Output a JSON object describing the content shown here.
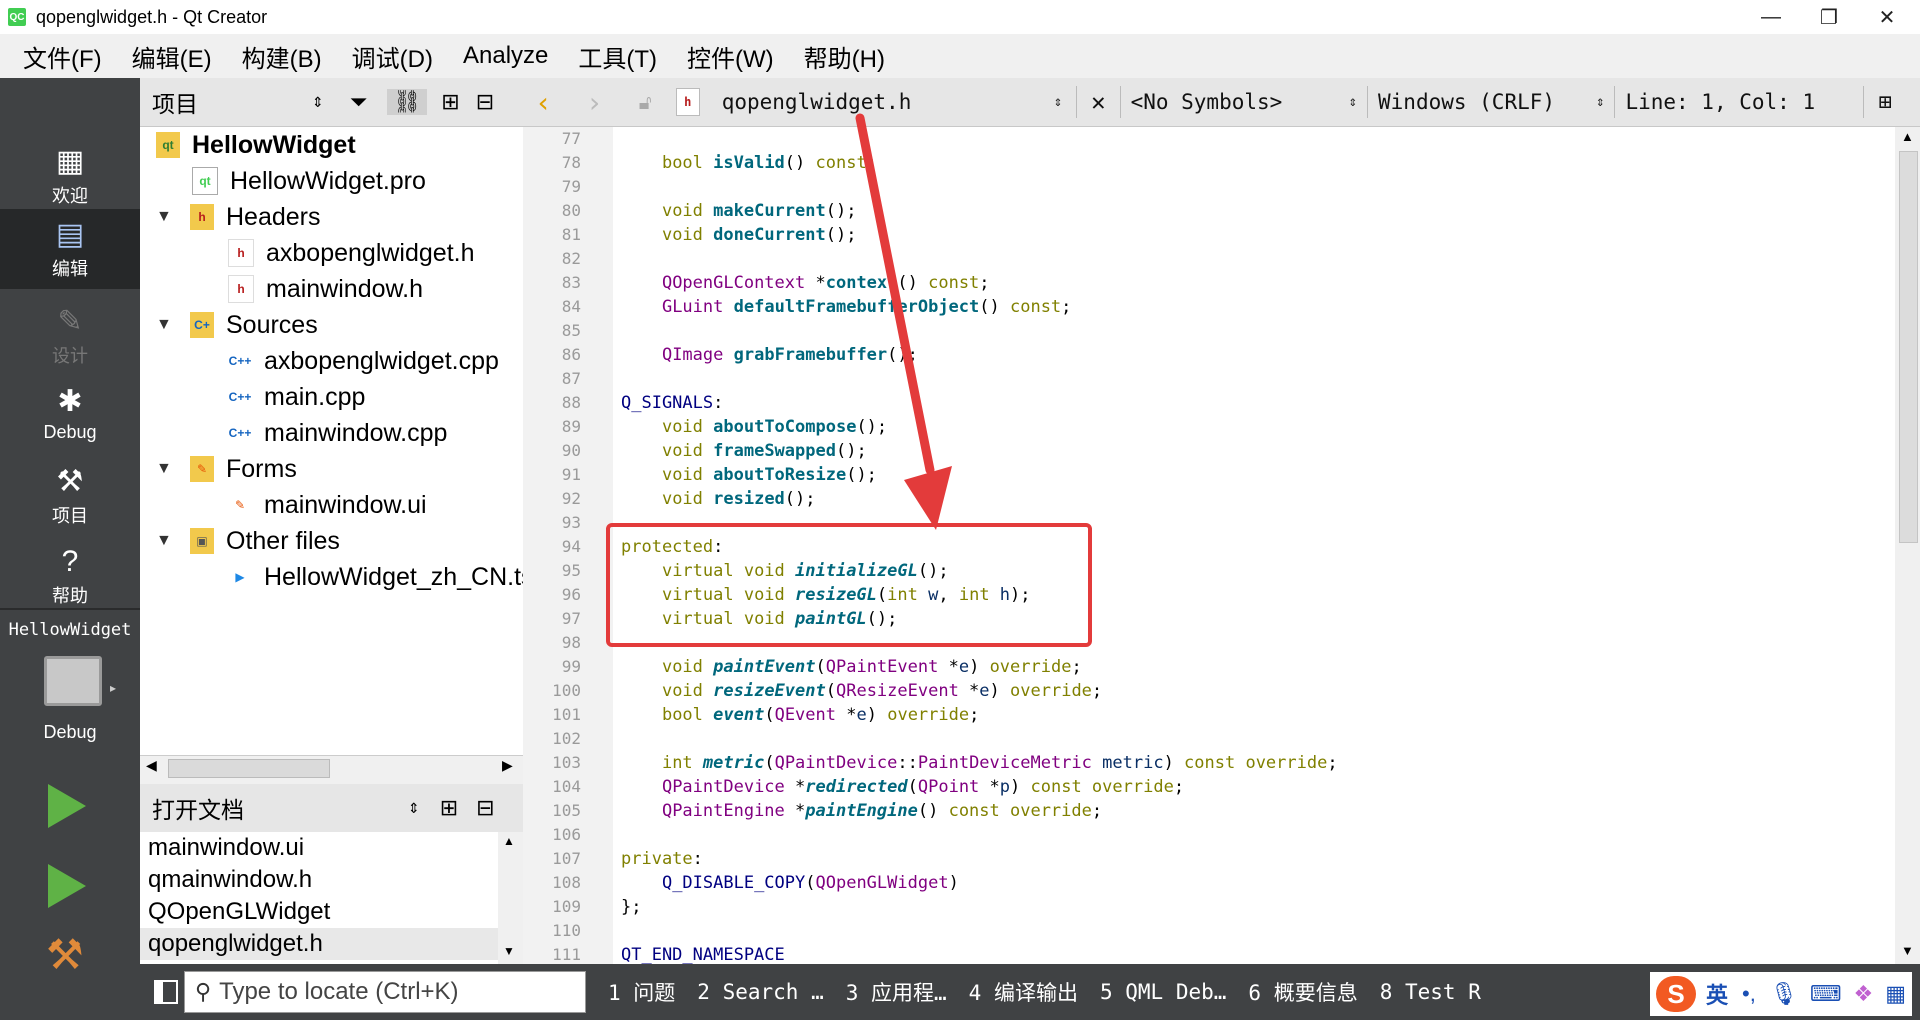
{
  "window": {
    "title": "qopenglwidget.h - Qt Creator",
    "minimize": "—",
    "maximize": "❐",
    "close": "✕"
  },
  "menu": [
    "文件(F)",
    "编辑(E)",
    "构建(B)",
    "调试(D)",
    "Analyze",
    "工具(T)",
    "控件(W)",
    "帮助(H)"
  ],
  "modes": {
    "welcome": "欢迎",
    "edit": "编辑",
    "design": "设计",
    "debug": "Debug",
    "projects": "项目",
    "help": "帮助",
    "kit_project": "HellowWidget",
    "kit_build": "Debug"
  },
  "project_panel": {
    "title": "项目"
  },
  "tree": {
    "root": "HellowWidget",
    "pro": "HellowWidget.pro",
    "headers": "Headers",
    "h1": "axbopenglwidget.h",
    "h2": "mainwindow.h",
    "sources": "Sources",
    "s1": "axbopenglwidget.cpp",
    "s2": "main.cpp",
    "s3": "mainwindow.cpp",
    "forms": "Forms",
    "f1": "mainwindow.ui",
    "other": "Other files",
    "o1": "HellowWidget_zh_CN.ts"
  },
  "open_docs": {
    "title": "打开文档",
    "items": [
      "mainwindow.ui",
      "qmainwindow.h",
      "QOpenGLWidget",
      "qopenglwidget.h"
    ]
  },
  "editor_toolbar": {
    "file": "qopenglwidget.h",
    "symbols": "<No Symbols>",
    "line_ending": "Windows (CRLF)",
    "position": "Line: 1, Col: 1"
  },
  "code": {
    "l77": "77",
    "l78": "78",
    "l79": "79",
    "l80": "80",
    "l81": "81",
    "l82": "82",
    "l83": "83",
    "l84": "84",
    "l85": "85",
    "l86": "86",
    "l87": "87",
    "l88": "88",
    "l89": "89",
    "l90": "90",
    "l91": "91",
    "l92": "92",
    "l93": "93",
    "l94": "94",
    "l95": "95",
    "l96": "96",
    "l97": "97",
    "l98": "98",
    "l99": "99",
    "l100": "100",
    "l101": "101",
    "l102": "102",
    "l103": "103",
    "l104": "104",
    "l105": "105",
    "l106": "106",
    "l107": "107",
    "l108": "108",
    "l109": "109",
    "l110": "110",
    "l111": "111"
  },
  "status": {
    "locate_placeholder": "Type to locate (Ctrl+K)",
    "panes": [
      "1  问题",
      "2  Search …",
      "3  应用程…",
      "4  编译输出",
      "5  QML Deb…",
      "6  概要信息",
      "8  Test R"
    ]
  },
  "ime": {
    "lang": "英"
  }
}
